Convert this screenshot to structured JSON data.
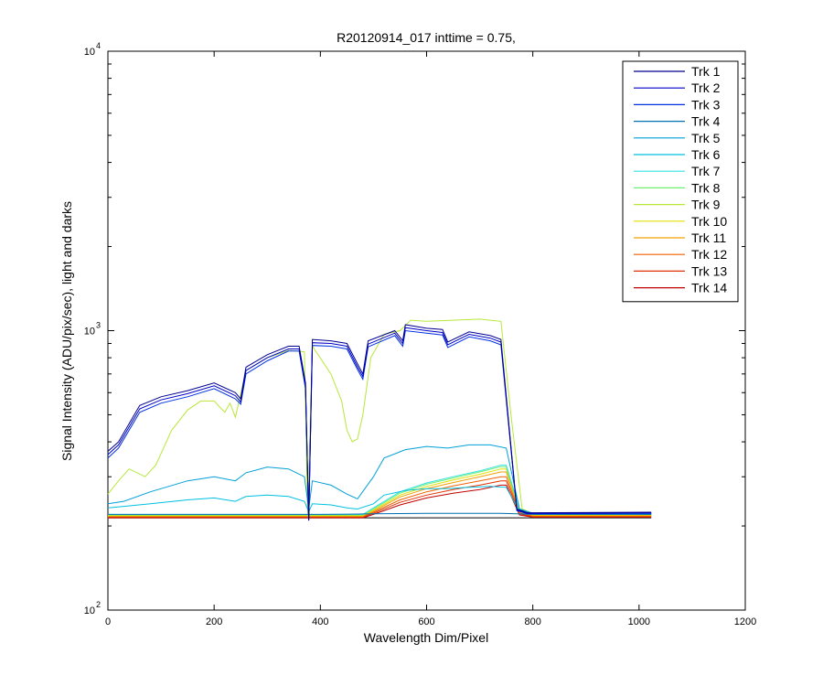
{
  "chart_data": {
    "type": "line",
    "title": "R20120914_017 inttime = 0.75,",
    "xlabel": "Wavelength Dim/Pixel",
    "ylabel": "Signal Intensity (ADU/pix/sec), light and darks",
    "xlim": [
      0,
      1200
    ],
    "ylim": [
      100,
      10000
    ],
    "yscale": "log",
    "x_ticks": [
      0,
      200,
      400,
      600,
      800,
      1000,
      1200
    ],
    "x_tick_labels": [
      "0",
      "200",
      "400",
      "600",
      "800",
      "1000",
      "1200"
    ],
    "y_ticks": [
      {
        "value": 100,
        "base": "10",
        "exp": "2"
      },
      {
        "value": 1000,
        "base": "10",
        "exp": "3"
      },
      {
        "value": 10000,
        "base": "10",
        "exp": "4"
      }
    ],
    "grid": false,
    "legend_position": "top-right",
    "series": [
      {
        "name": "Trk 1",
        "color": "#00008f",
        "x": [
          0,
          20,
          60,
          100,
          150,
          200,
          240,
          250,
          260,
          300,
          340,
          360,
          372,
          378,
          385,
          420,
          450,
          470,
          480,
          490,
          540,
          555,
          560,
          600,
          630,
          640,
          680,
          720,
          740,
          770,
          790,
          1023
        ],
        "y": [
          370,
          400,
          540,
          580,
          610,
          650,
          600,
          570,
          740,
          820,
          880,
          880,
          650,
          210,
          930,
          920,
          900,
          760,
          700,
          920,
          1000,
          920,
          1050,
          1020,
          1010,
          910,
          990,
          960,
          930,
          230,
          223,
          224
        ]
      },
      {
        "name": "Trk 2",
        "color": "#0000c8",
        "x": [
          0,
          20,
          60,
          100,
          150,
          200,
          240,
          250,
          260,
          300,
          340,
          360,
          372,
          378,
          385,
          420,
          450,
          470,
          480,
          490,
          540,
          555,
          560,
          600,
          630,
          640,
          680,
          720,
          740,
          770,
          790,
          1023
        ],
        "y": [
          360,
          390,
          525,
          565,
          595,
          635,
          585,
          555,
          720,
          800,
          860,
          860,
          635,
          210,
          905,
          900,
          880,
          740,
          685,
          895,
          980,
          900,
          1025,
          1000,
          985,
          890,
          970,
          940,
          910,
          228,
          222,
          223
        ]
      },
      {
        "name": "Trk 3",
        "color": "#0030e0",
        "x": [
          0,
          20,
          60,
          100,
          150,
          200,
          240,
          250,
          260,
          300,
          340,
          360,
          372,
          378,
          385,
          420,
          450,
          470,
          480,
          490,
          540,
          555,
          560,
          600,
          630,
          640,
          680,
          720,
          740,
          770,
          790,
          1023
        ],
        "y": [
          350,
          380,
          510,
          550,
          580,
          620,
          570,
          545,
          700,
          780,
          845,
          845,
          620,
          209,
          885,
          880,
          860,
          725,
          670,
          875,
          960,
          880,
          1000,
          980,
          965,
          870,
          950,
          920,
          890,
          227,
          221,
          222
        ]
      },
      {
        "name": "Trk 4",
        "color": "#0070b0",
        "x": [
          0,
          200,
          400,
          500,
          600,
          700,
          740,
          770,
          800,
          1023
        ],
        "y": [
          220,
          220,
          220,
          221,
          222,
          222,
          222,
          221,
          220,
          220
        ]
      },
      {
        "name": "Trk 5",
        "color": "#00a0d8",
        "x": [
          0,
          30,
          80,
          150,
          200,
          240,
          260,
          300,
          340,
          370,
          378,
          385,
          420,
          450,
          470,
          500,
          520,
          560,
          600,
          640,
          680,
          720,
          750,
          775,
          800,
          1023
        ],
        "y": [
          240,
          245,
          265,
          290,
          300,
          290,
          310,
          325,
          320,
          300,
          230,
          290,
          280,
          260,
          250,
          300,
          350,
          375,
          385,
          380,
          390,
          390,
          380,
          230,
          222,
          222
        ]
      },
      {
        "name": "Trk 6",
        "color": "#00c0e0",
        "x": [
          0,
          30,
          80,
          150,
          200,
          240,
          260,
          300,
          340,
          370,
          378,
          385,
          420,
          450,
          470,
          500,
          520,
          560,
          600,
          640,
          680,
          720,
          750,
          775,
          800,
          1023
        ],
        "y": [
          232,
          235,
          240,
          248,
          252,
          245,
          255,
          258,
          255,
          245,
          225,
          240,
          238,
          232,
          230,
          240,
          258,
          268,
          272,
          272,
          275,
          277,
          275,
          225,
          221,
          221
        ]
      },
      {
        "name": "Trk 7",
        "color": "#30e0e0",
        "x": [
          0,
          200,
          400,
          480,
          500,
          550,
          600,
          650,
          700,
          740,
          750,
          775,
          800,
          1023
        ],
        "y": [
          220,
          220,
          220,
          220,
          232,
          265,
          285,
          300,
          315,
          330,
          330,
          230,
          221,
          221
        ]
      },
      {
        "name": "Trk 8",
        "color": "#70f070",
        "x": [
          0,
          200,
          400,
          480,
          500,
          550,
          600,
          650,
          700,
          740,
          750,
          775,
          800,
          1023
        ],
        "y": [
          219,
          219,
          219,
          219,
          230,
          262,
          282,
          297,
          312,
          326,
          326,
          228,
          220,
          220
        ]
      },
      {
        "name": "Trk 9",
        "color": "#b8e838",
        "x": [
          0,
          20,
          40,
          70,
          90,
          120,
          150,
          175,
          200,
          220,
          230,
          240,
          260,
          300,
          340,
          370,
          376,
          385,
          420,
          440,
          450,
          460,
          470,
          480,
          495,
          520,
          550,
          570,
          600,
          650,
          700,
          720,
          740,
          760,
          780,
          800,
          1023
        ],
        "y": [
          260,
          290,
          320,
          300,
          330,
          440,
          520,
          560,
          560,
          510,
          550,
          490,
          720,
          800,
          850,
          840,
          220,
          880,
          700,
          560,
          440,
          400,
          410,
          500,
          800,
          970,
          1000,
          1090,
          1080,
          1090,
          1100,
          1090,
          1080,
          480,
          230,
          222,
          222
        ]
      },
      {
        "name": "Trk 10",
        "color": "#e0e000",
        "x": [
          0,
          200,
          400,
          480,
          500,
          550,
          600,
          650,
          700,
          740,
          750,
          775,
          800,
          1023
        ],
        "y": [
          218,
          218,
          218,
          218,
          228,
          258,
          277,
          292,
          306,
          320,
          320,
          227,
          219,
          219
        ]
      },
      {
        "name": "Trk 11",
        "color": "#f0a000",
        "x": [
          0,
          200,
          400,
          480,
          500,
          550,
          600,
          650,
          700,
          740,
          750,
          775,
          800,
          1023
        ],
        "y": [
          217,
          217,
          217,
          217,
          226,
          254,
          272,
          286,
          300,
          312,
          312,
          225,
          218,
          218
        ]
      },
      {
        "name": "Trk 12",
        "color": "#f06000",
        "x": [
          0,
          200,
          400,
          480,
          500,
          550,
          600,
          650,
          700,
          740,
          750,
          775,
          800,
          1023
        ],
        "y": [
          216,
          216,
          216,
          216,
          224,
          248,
          265,
          278,
          290,
          300,
          300,
          223,
          217,
          217
        ]
      },
      {
        "name": "Trk 13",
        "color": "#e03000",
        "x": [
          0,
          200,
          400,
          480,
          500,
          550,
          600,
          650,
          700,
          740,
          750,
          775,
          800,
          1023
        ],
        "y": [
          215,
          215,
          215,
          215,
          222,
          243,
          258,
          270,
          280,
          290,
          290,
          221,
          216,
          216
        ]
      },
      {
        "name": "Trk 14",
        "color": "#c00000",
        "x": [
          0,
          200,
          400,
          480,
          500,
          550,
          600,
          650,
          700,
          740,
          750,
          775,
          800,
          1023
        ],
        "y": [
          214,
          214,
          214,
          214,
          220,
          238,
          252,
          262,
          270,
          280,
          280,
          219,
          215,
          215
        ]
      }
    ],
    "dark_series": [
      {
        "color": "#000000",
        "x": [
          0,
          1023
        ],
        "y": [
          214,
          214
        ]
      }
    ]
  }
}
